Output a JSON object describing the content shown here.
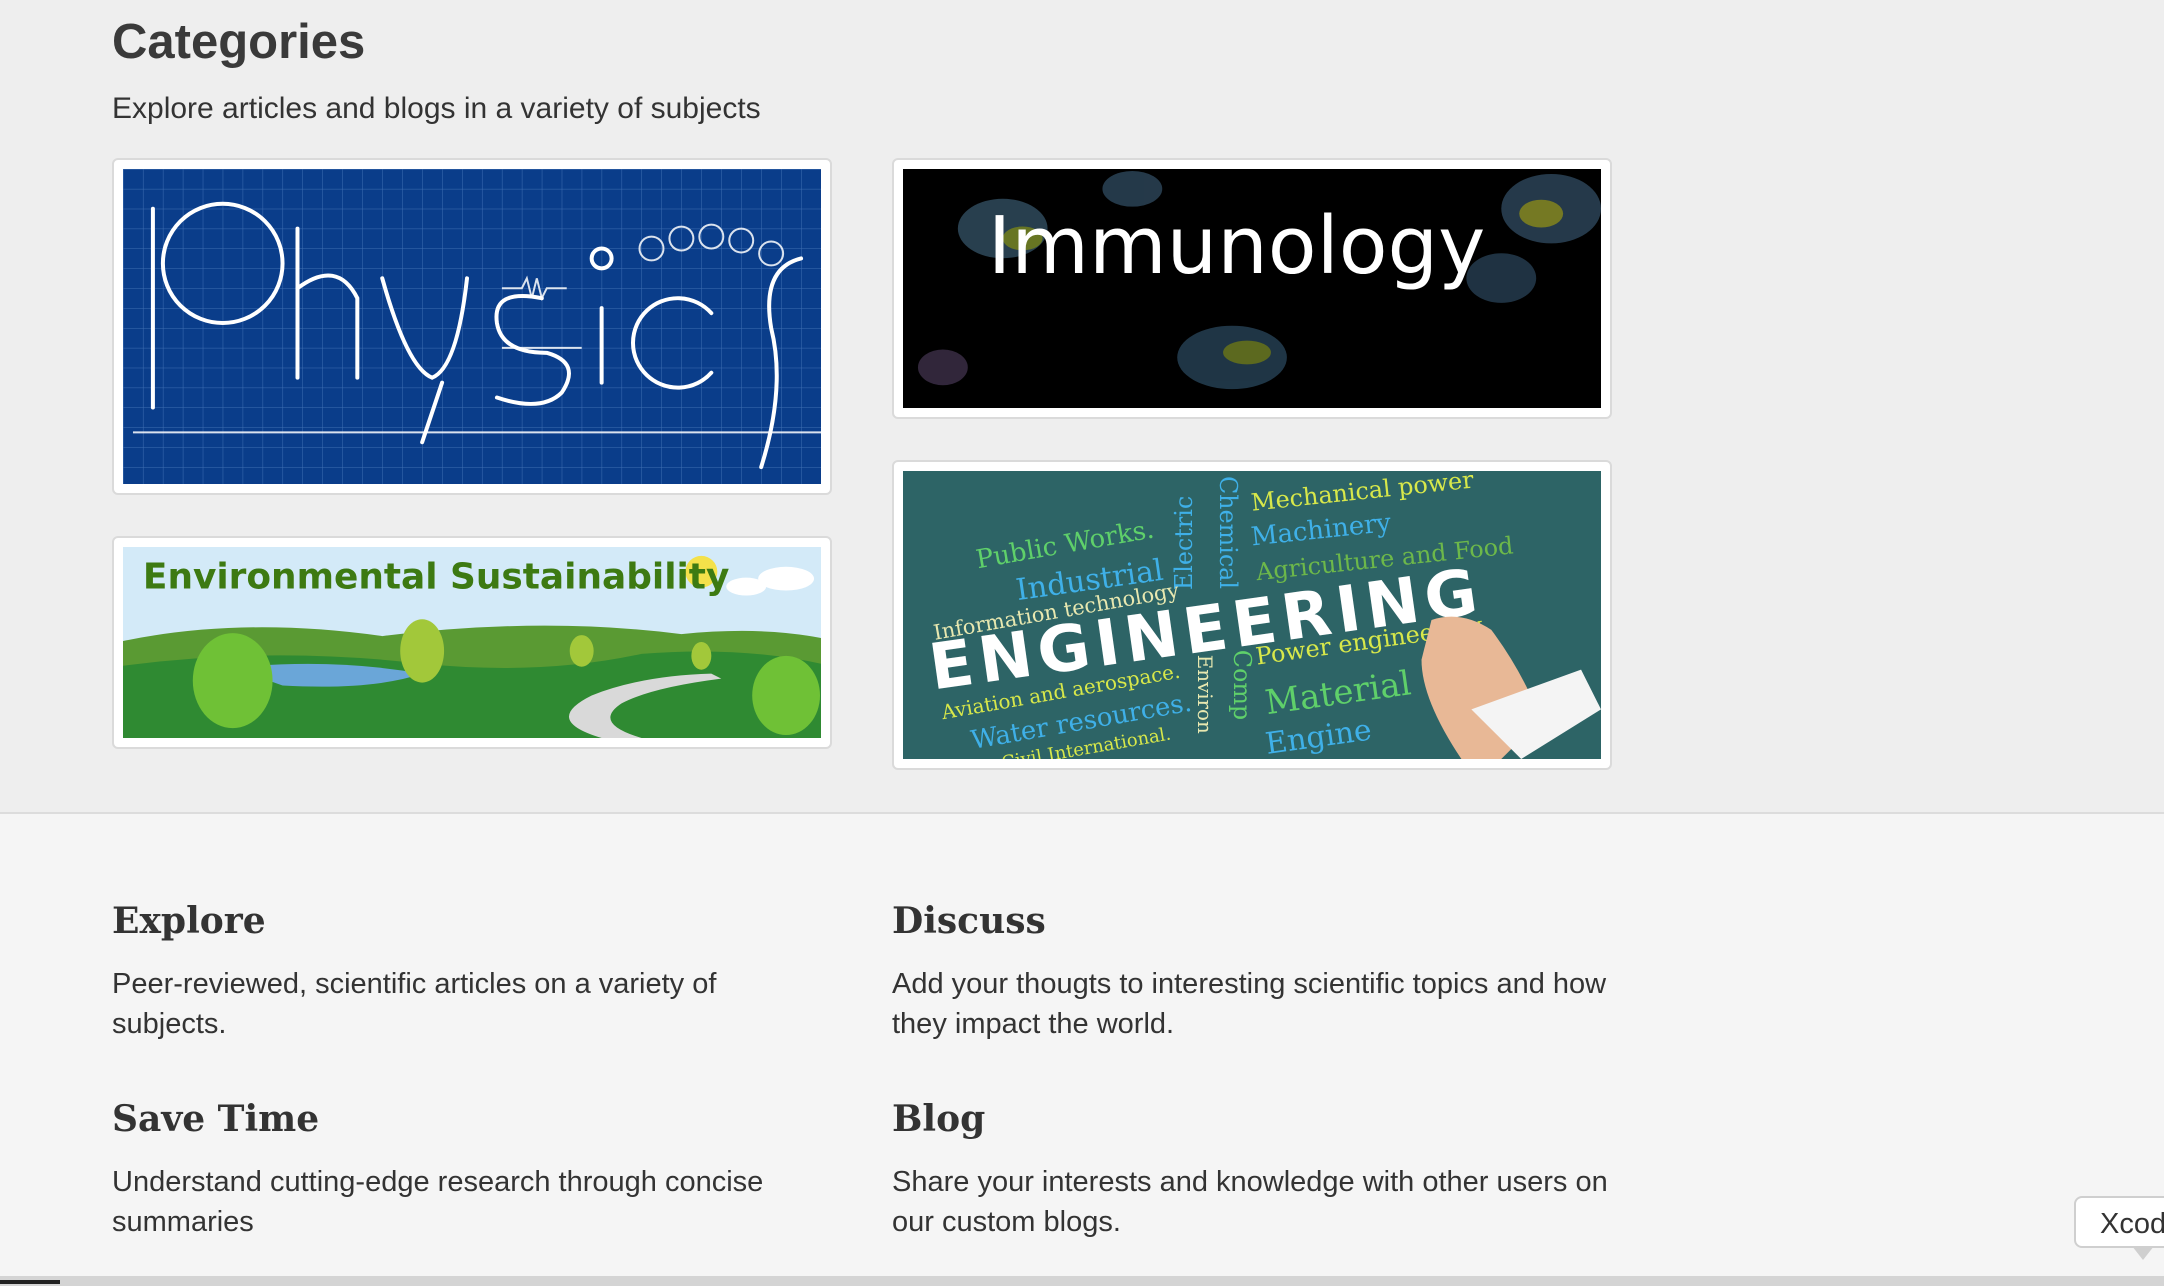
{
  "categories": {
    "title": "Categories",
    "subtitle": "Explore articles and blogs in a variety of subjects",
    "cards": {
      "physics": {
        "label": "Physics"
      },
      "immunology": {
        "label": "Immunology"
      },
      "environmental": {
        "label": "Environmental Sustainability"
      },
      "engineering": {
        "label": "ENGINEERING",
        "words": [
          "Mechanical power",
          "Public Works.",
          "Industrial",
          "Machinery",
          "Agriculture and Food",
          "Information technology",
          "Power engineering",
          "Aviation and aerospace.",
          "Material",
          "Water resources.",
          "Engine",
          "Civil International.",
          "Electric",
          "Chemical",
          "Environ",
          "Comp"
        ]
      }
    }
  },
  "features": [
    {
      "title": "Explore",
      "text": "Peer-reviewed, scientific articles on a variety of subjects."
    },
    {
      "title": "Discuss",
      "text": "Add your thougts to interesting scientific topics and how they impact the world."
    },
    {
      "title": "Save Time",
      "text": "Understand cutting-edge research through concise summaries"
    },
    {
      "title": "Blog",
      "text": "Share your interests and knowledge with other users on our custom blogs."
    }
  ],
  "tooltip": {
    "text": "Xcode"
  },
  "colors": {
    "physics_bg": "#0a3d8a",
    "immunology_bg": "#000000",
    "engineering_bg": "#2d6466",
    "env_title": "#3d7a12"
  }
}
